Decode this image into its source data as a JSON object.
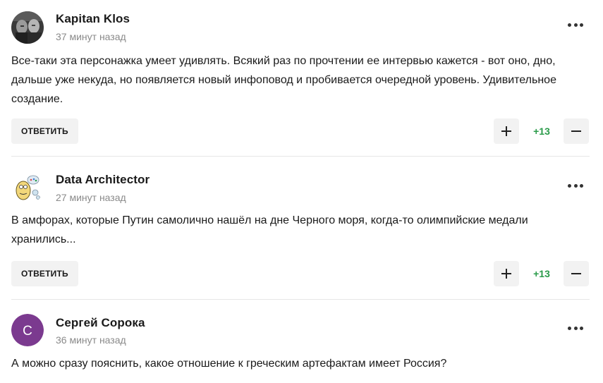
{
  "reply_label": "ОТВЕТИТЬ",
  "comments": [
    {
      "author": "Kapitan Klos",
      "time": "37 минут назад",
      "text": "Все-таки эта персонажка умеет удивлять. Всякий раз по прочтении ее интервью кажется - вот оно, дно, дальше уже некуда, но появляется новый инфоповод и пробивается очередной уровень. Удивительное создание.",
      "score": "+13",
      "avatar": "photo-avatar-icon"
    },
    {
      "author": "Data Architector",
      "time": "27 минут назад",
      "text": "В амфорах, которые Путин самолично нашёл на дне Черного моря, когда-то олимпийские медали хранились...",
      "score": "+13",
      "avatar": "cartoon-avatar-icon"
    },
    {
      "author": "Сергей Сорока",
      "time": "36 минут назад",
      "text": "А можно сразу пояснить, какое отношение к греческим артефактам имеет Россия?",
      "avatar_letter": "С",
      "avatar_color": "#7b3a8f"
    }
  ],
  "colors": {
    "score": "#2a9b4a",
    "button_bg": "#f2f2f2",
    "time": "#8a8a8a"
  }
}
